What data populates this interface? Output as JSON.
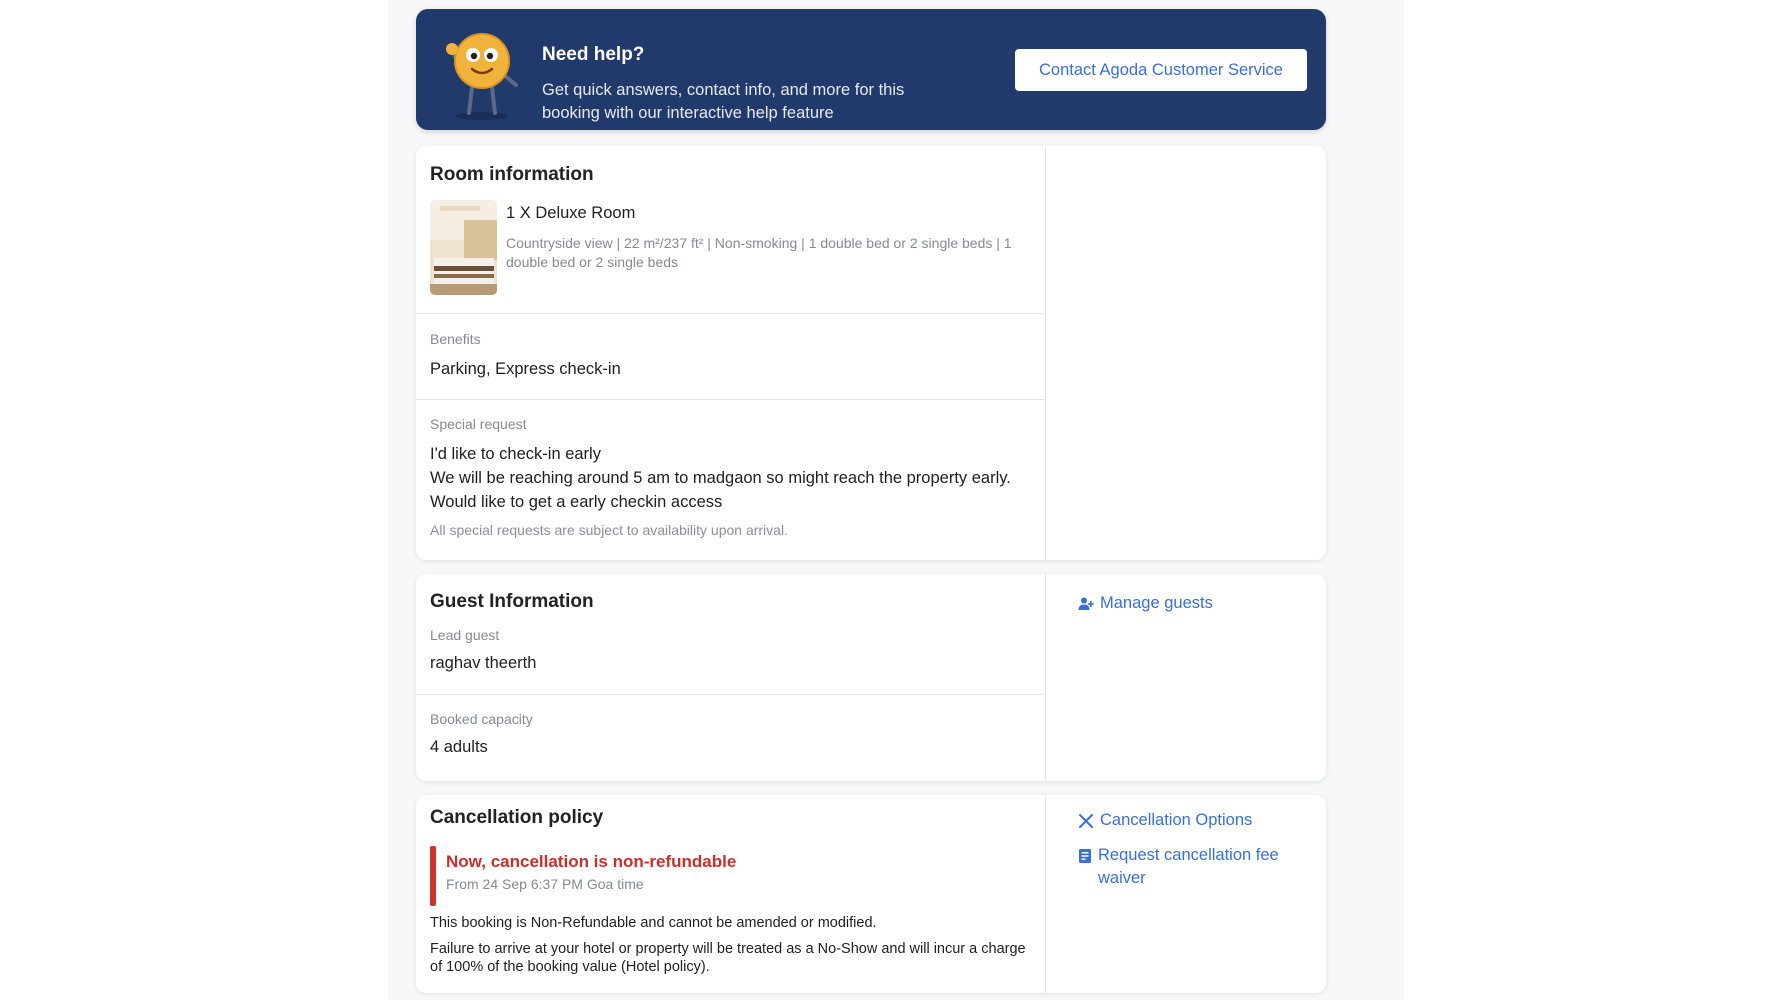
{
  "help_banner": {
    "title": "Need help?",
    "text": "Get quick answers, contact info, and more for this booking with our interactive help feature",
    "button_label": "Contact Agoda Customer Service"
  },
  "room_info": {
    "title": "Room information",
    "room_name": "1 X Deluxe Room",
    "room_desc": "Countryside view | 22 m²/237 ft² | Non-smoking | 1 double bed or 2 single beds | 1 double bed or 2 single beds",
    "benefits_label": "Benefits",
    "benefits_value": "Parking, Express check-in",
    "special_request_label": "Special request",
    "special_request_line1": "I'd like to check-in early",
    "special_request_line2": "We will be reaching around 5 am to madgaon so might reach the property early. Would like to get a early checkin access",
    "special_request_note": "All special requests are subject to availability upon arrival."
  },
  "guest_info": {
    "title": "Guest Information",
    "lead_guest_label": "Lead guest",
    "lead_guest_value": "raghav theerth",
    "capacity_label": "Booked capacity",
    "capacity_value": "4 adults",
    "manage_guests_label": "Manage guests"
  },
  "cancellation": {
    "title": "Cancellation policy",
    "status_title": "Now, cancellation is non-refundable",
    "status_sub": "From 24 Sep 6:37 PM Goa time",
    "text1": "This booking is Non-Refundable and cannot be amended or modified.",
    "text2": "Failure to arrive at your hotel or property will be treated as a No-Show and will incur a charge of 100% of the booking value (Hotel policy).",
    "options_label": "Cancellation Options",
    "fee_waiver_label": "Request cancellation fee waiver"
  },
  "colors": {
    "banner_bg": "#223a6b",
    "link": "#3b6fd8",
    "alert": "#c9302c"
  }
}
